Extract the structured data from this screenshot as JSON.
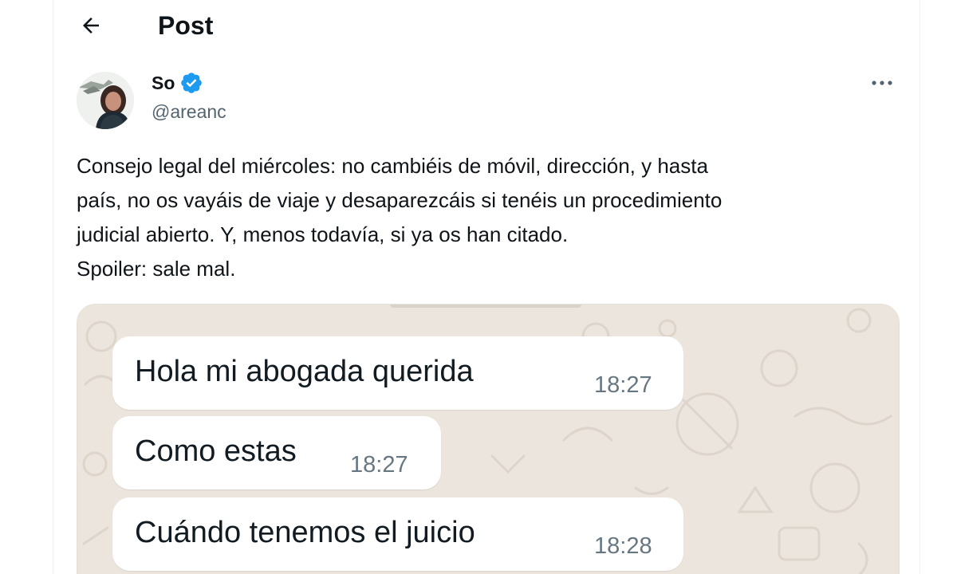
{
  "header": {
    "title": "Post",
    "back_icon": "arrow-left-icon"
  },
  "author": {
    "display_name": "So",
    "handle": "@areanc",
    "verified": true,
    "verified_color": "#1d9bf0"
  },
  "post": {
    "text_lines": [
      "Consejo legal del miércoles: no cambiéis de móvil, dirección, y hasta",
      "país, no os vayáis de viaje y desaparezcáis si tenéis un procedimiento",
      "judicial abierto. Y, menos todavía, si ya os han citado.",
      "Spoiler: sale mal."
    ],
    "more_icon": "more-horizontal-icon"
  },
  "media": {
    "type": "chat-screenshot",
    "background_color": "#ece5dd",
    "messages": [
      {
        "text": "Hola mi abogada querida",
        "time": "18:27"
      },
      {
        "text": "Como estas",
        "time": "18:27"
      },
      {
        "text": "Cuándo tenemos el juicio",
        "time": "18:28"
      }
    ]
  }
}
